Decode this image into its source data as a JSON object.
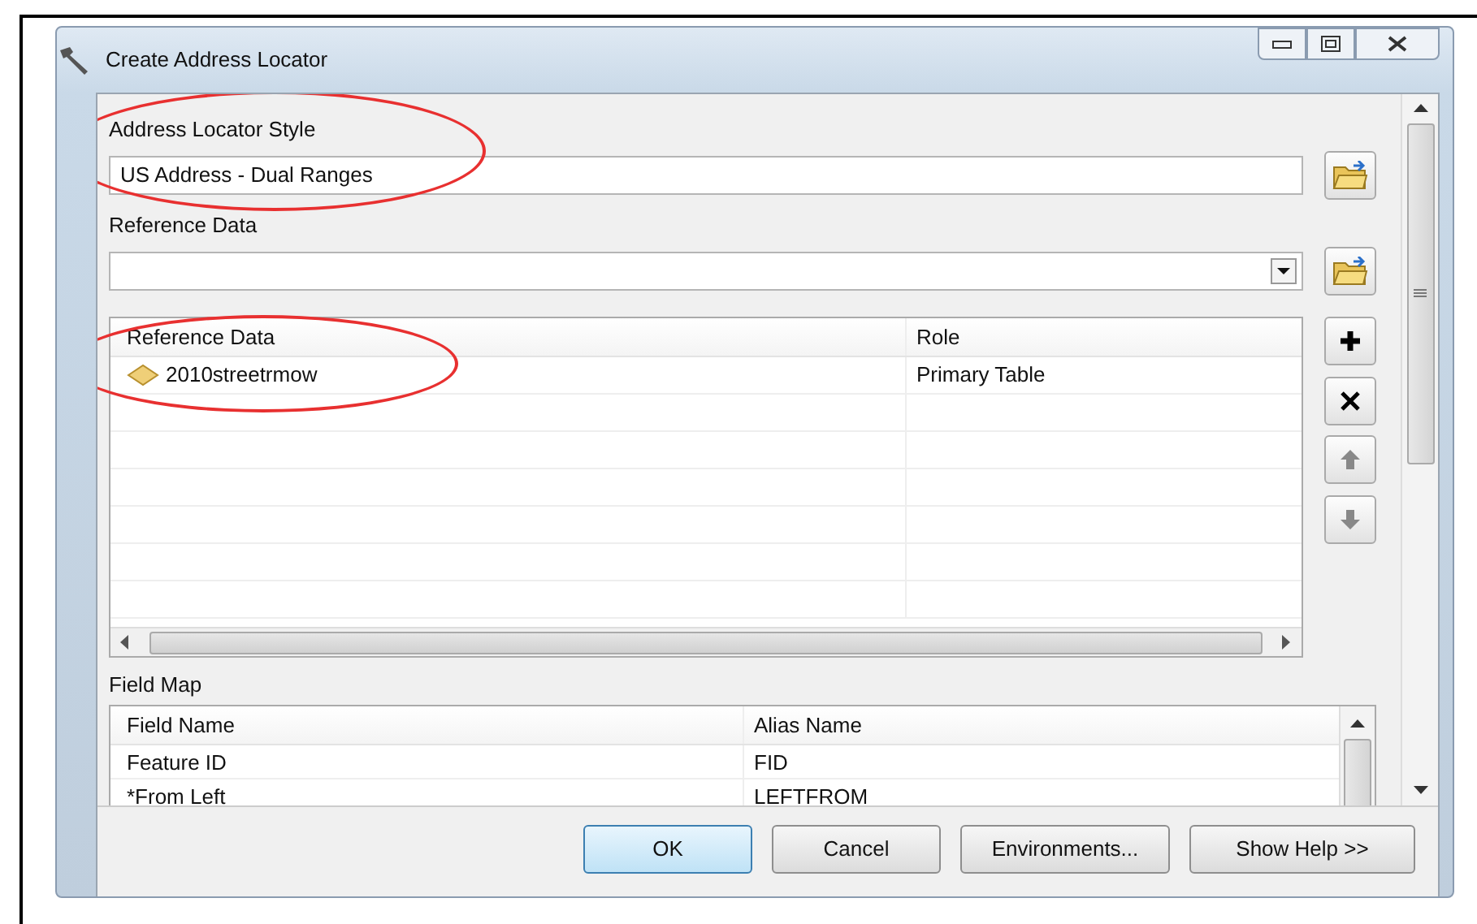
{
  "window": {
    "title": "Create Address Locator"
  },
  "address_locator_style": {
    "label": "Address Locator Style",
    "value": "US Address - Dual Ranges",
    "circled": true
  },
  "reference_data": {
    "label": "Reference Data"
  },
  "reference_table": {
    "columns": [
      "Reference Data",
      "Role"
    ],
    "circled": true,
    "rows": [
      {
        "name": "2010streetrmow",
        "role": "Primary Table"
      }
    ]
  },
  "field_map": {
    "label": "Field Map",
    "columns": [
      "Field Name",
      "Alias Name"
    ],
    "rows": [
      {
        "field": "Feature ID",
        "alias": "FID"
      },
      {
        "field": "*From Left",
        "alias": "LEFTFROM"
      }
    ]
  },
  "buttons": [
    {
      "label": "OK",
      "default": true
    },
    {
      "label": "Cancel",
      "default": false
    },
    {
      "label": "Environments...",
      "default": false
    },
    {
      "label": "Show Help >>",
      "default": false
    }
  ]
}
